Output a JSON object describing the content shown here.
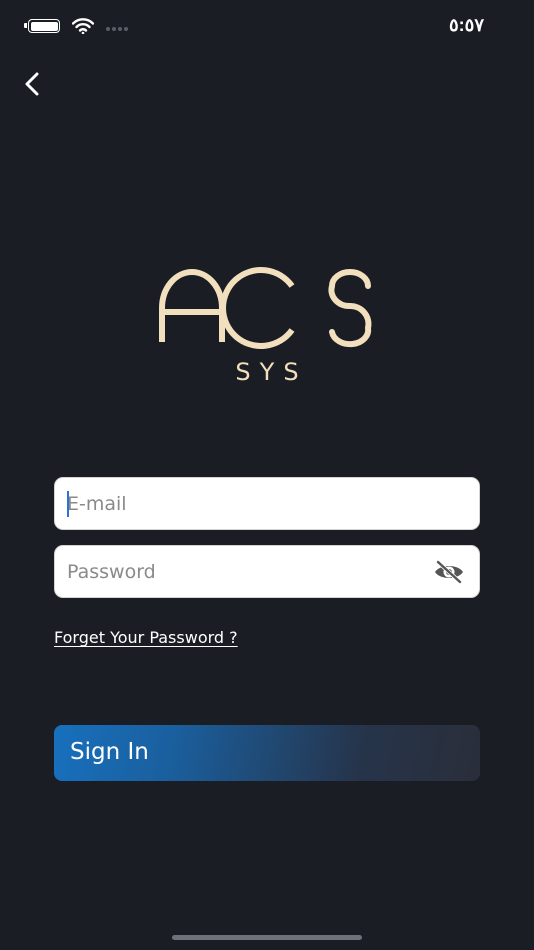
{
  "status_bar": {
    "time": "٥:٥٧",
    "icons": [
      "battery-icon",
      "wifi-icon",
      "cellular-signal-icon"
    ]
  },
  "navigation": {
    "back_icon": "chevron-left-icon"
  },
  "logo": {
    "mark": "ACS",
    "subtitle": "SYS",
    "color": "#f2dfbd"
  },
  "form": {
    "email": {
      "value": "",
      "placeholder": "E-mail"
    },
    "password": {
      "value": "",
      "placeholder": "Password",
      "toggle_icon": "eye-off-icon"
    },
    "forgot_password_label": "Forget Your Password ?",
    "sign_in_label": "Sign In"
  },
  "colors": {
    "background": "#1b1d25",
    "accent": "#1870bd",
    "logo_gold": "#f2dfbd"
  }
}
